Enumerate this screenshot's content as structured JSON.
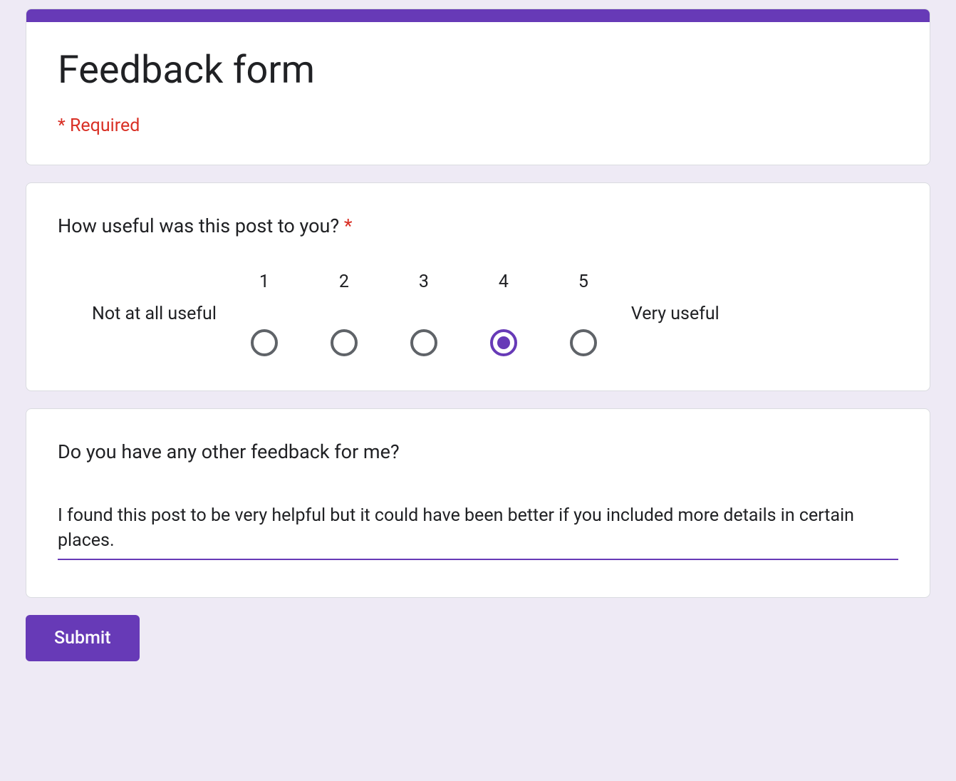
{
  "header": {
    "title": "Feedback form",
    "required_note": "* Required"
  },
  "questions": {
    "rating": {
      "title": "How useful was this post to you? ",
      "required_marker": "*",
      "low_label": "Not at all useful",
      "high_label": "Very useful",
      "options": [
        "1",
        "2",
        "3",
        "4",
        "5"
      ],
      "selected": "4"
    },
    "feedback": {
      "title": "Do you have any other feedback for me?",
      "value": "I found this post to be very helpful but it could have been better if you included more details in certain places."
    }
  },
  "submit_label": "Submit",
  "colors": {
    "accent": "#673ab7",
    "background": "#eeeaf5",
    "required": "#d93025"
  }
}
